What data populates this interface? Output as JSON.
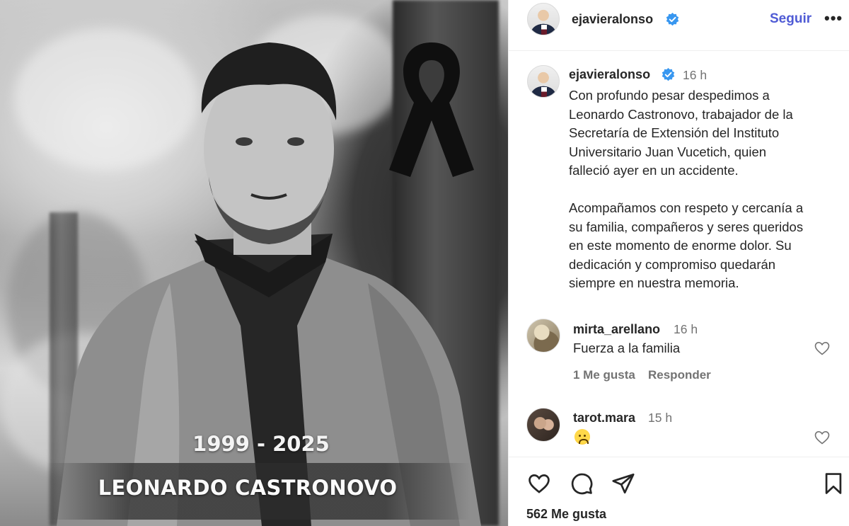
{
  "photo": {
    "dates": "1999 - 2025",
    "name": "LEONARDO CASTRONOVO"
  },
  "header": {
    "username": "ejavieralonso",
    "follow_label": "Seguir",
    "more_label": "•••"
  },
  "caption": {
    "username": "ejavieralonso",
    "time": "16 h",
    "text": "Con profundo pesar despedimos a\nLeonardo Castronovo, trabajador de la\nSecretaría de Extensión del Instituto\nUniversitario Juan Vucetich, quien\nfalleció ayer en un accidente.\n\nAcompañamos con respeto y cercanía a\nsu familia, compañeros y seres queridos\nen este momento de enorme dolor. Su\ndedicación y compromiso quedarán\nsiempre en nuestra memoria."
  },
  "comments": [
    {
      "username": "mirta_arellano",
      "time": "16 h",
      "text": "Fuerza a la familia",
      "likes_label": "1 Me gusta",
      "reply_label": "Responder"
    },
    {
      "username": "tarot.mara",
      "time": "15 h",
      "emoji": "crying-face-emoji"
    }
  ],
  "actions": {
    "likes_label": "562 Me gusta"
  },
  "colors": {
    "follow": "#4f5bd5",
    "verified": "#3897f0",
    "muted": "#737373"
  }
}
